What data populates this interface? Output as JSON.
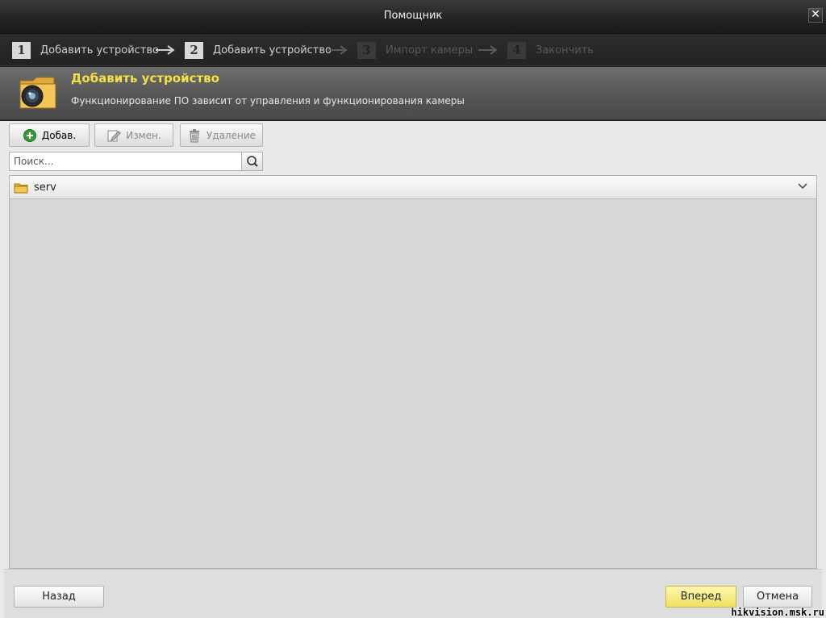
{
  "window": {
    "title": "Помощник"
  },
  "steps": [
    {
      "number": "1",
      "label": "Добавить устройство",
      "state": "active"
    },
    {
      "number": "2",
      "label": "Добавить устройство",
      "state": "active"
    },
    {
      "number": "3",
      "label": "Импорт камеры",
      "state": "inactive"
    },
    {
      "number": "4",
      "label": "Закончить",
      "state": "inactive"
    }
  ],
  "header": {
    "title": "Добавить устройство",
    "subtitle": "Функционирование ПО зависит от управления и функционирования камеры",
    "title_color": "#f2e045"
  },
  "toolbar": {
    "add_label": "Добав.",
    "edit_label": "Измен.",
    "delete_label": "Удаление"
  },
  "search": {
    "placeholder": "Поиск...",
    "value": ""
  },
  "tree": {
    "items": [
      {
        "name": "serv"
      }
    ]
  },
  "footer": {
    "back_label": "Назад",
    "next_label": "Вперед",
    "cancel_label": "Отмена"
  },
  "watermark": "hikvision.msk.ru"
}
